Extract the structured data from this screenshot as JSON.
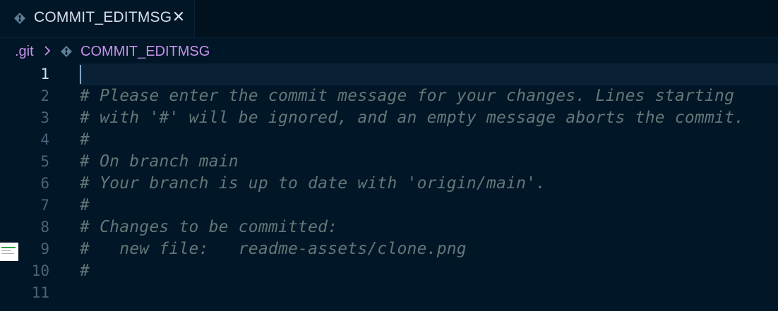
{
  "tab": {
    "label": "COMMIT_EDITMSG",
    "icon": "git-diamond-icon",
    "close_icon": "close-icon",
    "close_glyph": "✕"
  },
  "breadcrumb": {
    "root": ".git",
    "file": "COMMIT_EDITMSG"
  },
  "editor": {
    "active_line": 1,
    "lines": [
      {
        "num": "1",
        "text": ""
      },
      {
        "num": "2",
        "text": "# Please enter the commit message for your changes. Lines starting"
      },
      {
        "num": "3",
        "text": "# with '#' will be ignored, and an empty message aborts the commit."
      },
      {
        "num": "4",
        "text": "#"
      },
      {
        "num": "5",
        "text": "# On branch main"
      },
      {
        "num": "6",
        "text": "# Your branch is up to date with 'origin/main'."
      },
      {
        "num": "7",
        "text": "#"
      },
      {
        "num": "8",
        "text": "# Changes to be committed:"
      },
      {
        "num": "9",
        "text": "#   new file:   readme-assets/clone.png"
      },
      {
        "num": "10",
        "text": "#"
      },
      {
        "num": "11",
        "text": ""
      }
    ]
  },
  "colors": {
    "background": "#011627",
    "comment": "#637777",
    "accent": "#c792ea",
    "line_number": "#4b6479",
    "active_line_number": "#c5e4fd"
  }
}
